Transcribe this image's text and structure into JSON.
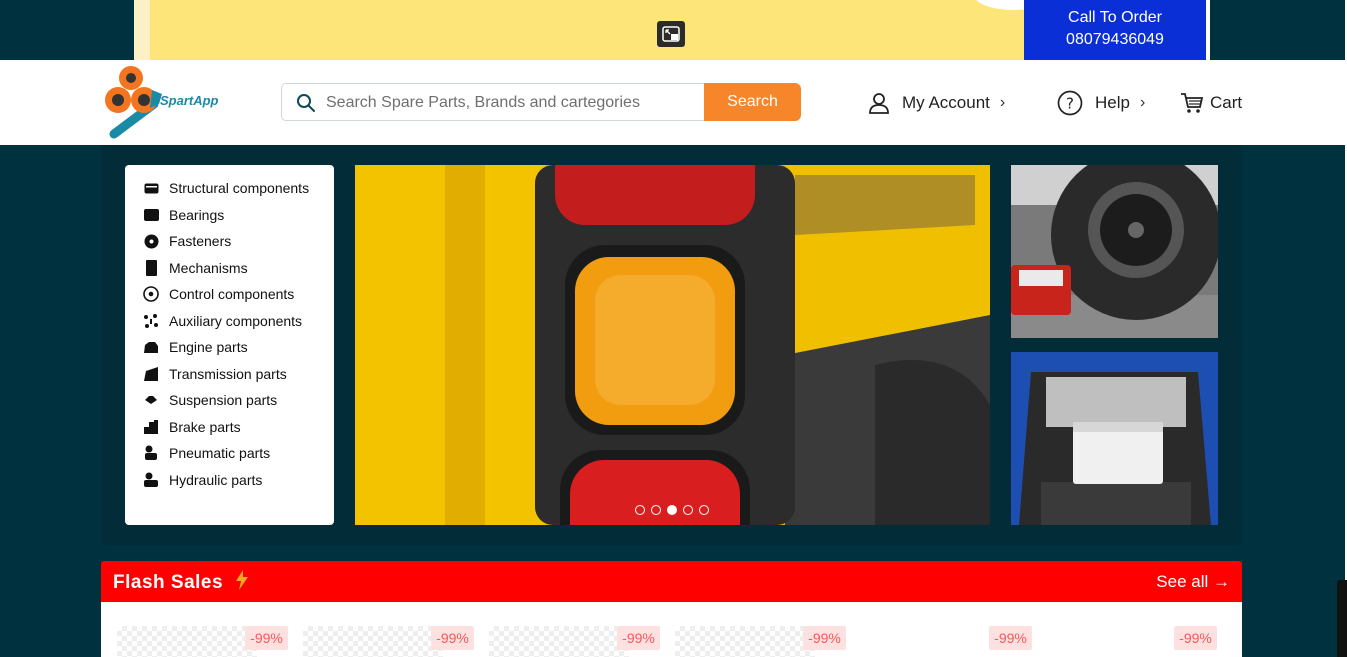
{
  "promo": {
    "call_line1": "Call To Order",
    "call_line2": "08079436049",
    "colors": {
      "bg": "#fde57a",
      "call_bg": "#0a2fd6"
    }
  },
  "header": {
    "brand": "SpartApp",
    "search": {
      "placeholder": "Search Spare Parts, Brands and cartegories",
      "button": "Search"
    },
    "nav": {
      "account": "My Account",
      "help": "Help",
      "cart": "Cart"
    },
    "colors": {
      "accent": "#f7862a",
      "page_bg": "#00313f"
    }
  },
  "categories": [
    {
      "label": "Structural components",
      "icon": "panel-icon"
    },
    {
      "label": "Bearings",
      "icon": "bearing-icon"
    },
    {
      "label": "Fasteners",
      "icon": "fastener-icon"
    },
    {
      "label": "Mechanisms",
      "icon": "mechanism-icon"
    },
    {
      "label": "Control components",
      "icon": "control-icon"
    },
    {
      "label": "Auxiliary components",
      "icon": "auxiliary-icon"
    },
    {
      "label": "Engine parts",
      "icon": "engine-icon"
    },
    {
      "label": "Transmission parts",
      "icon": "transmission-icon"
    },
    {
      "label": "Suspension parts",
      "icon": "suspension-icon"
    },
    {
      "label": "Brake parts",
      "icon": "brake-icon"
    },
    {
      "label": "Pneumatic parts",
      "icon": "pneumatic-icon"
    },
    {
      "label": "Hydraulic parts",
      "icon": "hydraulic-icon"
    }
  ],
  "carousel": {
    "slide_count": 5,
    "active_slide": 3
  },
  "flash_sales": {
    "title": "Flash Sales",
    "see_all": "See all →",
    "colors": {
      "bar": "#fe0000",
      "badge_bg": "#fde1e1",
      "badge_text": "#f25a5a"
    },
    "products": [
      {
        "discount": "-99%"
      },
      {
        "discount": "-99%"
      },
      {
        "discount": "-99%"
      },
      {
        "discount": "-99%"
      },
      {
        "discount": "-99%"
      },
      {
        "discount": "-99%"
      }
    ]
  }
}
